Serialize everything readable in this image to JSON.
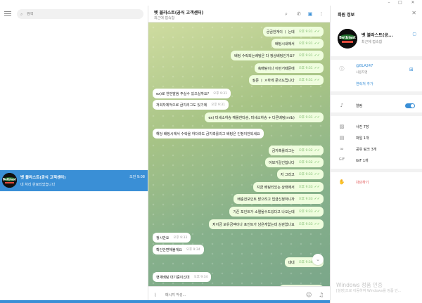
{
  "colors": {
    "accent": "#3a8fd6",
    "bubble_out": "#effdde",
    "bubble_in": "#ffffff",
    "danger": "#e05050"
  },
  "window": {
    "minimize_icon": "minimize-icon",
    "maximize_icon": "maximize-icon",
    "close_icon": "close-icon"
  },
  "sidebar": {
    "search_placeholder": "검색",
    "chat": {
      "name": "벳 블라스트(공식 고객센터)",
      "preview": "네 처리 완료되었습니다",
      "time": "오전 9:08"
    }
  },
  "chat_header": {
    "title": "벳 블라스트(공식 고객센터)",
    "subtitle": "최근에 접속함"
  },
  "messages": [
    {
      "dir": "out",
      "text": "궁금한게이 ㅣ 는데",
      "time": "오후 9:31"
    },
    {
      "dir": "out",
      "text": "배팅시내에서",
      "time": "오후 9:31"
    },
    {
      "dir": "out",
      "text": "배팅 수락되는배팅은 다 정상배팅인가요?",
      "time": "오후 9:31"
    },
    {
      "dir": "out",
      "text": "축배팅이나 이런거때문에",
      "time": "오후 9:31"
    },
    {
      "dir": "out",
      "text": "질문 ㅣ ㅊ하게 문의드립니다",
      "time": "오후 9:31"
    },
    {
      "dir": "in",
      "text": "ex)로 한번말씀 주실수 있으실까요?",
      "time": "오후 9:31"
    },
    {
      "dir": "in",
      "text": "저희자체적으로 금지리그도 있기에",
      "time": "오후 9:31"
    },
    {
      "dir": "out",
      "text": "ex) 미세소하승 예룰한타승, 미세소하승 + 다른배팅(mlb)",
      "time": "오후 9:31"
    },
    {
      "dir": "in",
      "text": "해당 배팅시에서 수락을 하더라도 금지축룰리그 배팅은 인정이안되세요",
      "time": ""
    },
    {
      "dir": "out",
      "text": "금지축룰리그는",
      "time": "오후 9:32"
    },
    {
      "dir": "out",
      "text": "어보거갈긴합니다",
      "time": "오후 9:32"
    },
    {
      "dir": "out",
      "text": "저 그리고",
      "time": "오후 9:33"
    },
    {
      "dir": "out",
      "text": "지금 배팅되있는 상태에서",
      "time": "오후 9:33"
    },
    {
      "dir": "out",
      "text": "배충전포인트 받으려고 입금신청하니까",
      "time": "오후 9:33"
    },
    {
      "dir": "out",
      "text": "기존 포인트가 소멸될수도있다고 나오는데",
      "time": "오후 9:33"
    },
    {
      "dir": "out",
      "text": "저지금 보유금액이나 포인트가 남은게없는데 상관없나요",
      "time": "오후 9:33"
    },
    {
      "dir": "in",
      "text": "정시만요",
      "time": "오후 9:33"
    },
    {
      "dir": "in",
      "text": "확인안변해볼게요",
      "time": "오후 9:34"
    },
    {
      "dir": "out",
      "text": "네네",
      "time": "오후 9:34"
    },
    {
      "dir": "in",
      "text": "현재배팅 대기중이신대",
      "time": "오후 9:34"
    },
    {
      "dir": "out",
      "text": "대기요?",
      "time": "오후 9:34"
    }
  ],
  "composer": {
    "placeholder": "메시지 작성..."
  },
  "info": {
    "title": "회원 정보",
    "name": "벳 블라스트(공...",
    "status": "최근에 접속함",
    "username": "@BLA247",
    "username_label": "사용자명",
    "add_contact": "연락처 추가",
    "notifications": "알림",
    "photos": "사진 7장",
    "files": "파일 1개",
    "links": "공유 링크 3개",
    "gifs": "GIF 1개",
    "block": "차단하기"
  },
  "watermark": {
    "line1": "Windows 정품 인증",
    "line2": "[설정]으로 이동하여 Windows를 정품 인..."
  },
  "logo_text": "Betblast"
}
